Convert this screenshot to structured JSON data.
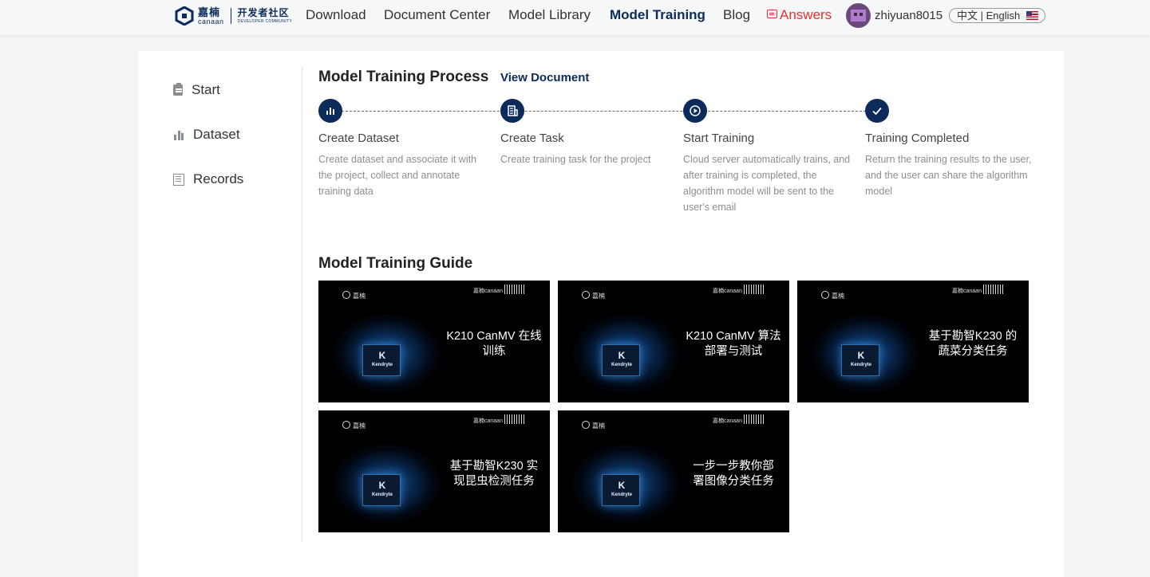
{
  "header": {
    "logo": {
      "cn": "嘉楠",
      "en": "canaan",
      "dev_cn": "开发者社区",
      "dev_en": "DEVELOPER COMMUNITY"
    },
    "nav": [
      {
        "label": "Download"
      },
      {
        "label": "Document Center"
      },
      {
        "label": "Model Library"
      },
      {
        "label": "Model Training",
        "active": true
      },
      {
        "label": "Blog"
      },
      {
        "label": "Answers"
      }
    ],
    "username": "zhiyuan8015",
    "language": "中文 | English"
  },
  "sidebar": {
    "items": [
      {
        "label": "Start",
        "icon": "clipboard-icon"
      },
      {
        "label": "Dataset",
        "icon": "bar-chart-icon"
      },
      {
        "label": "Records",
        "icon": "document-icon"
      }
    ]
  },
  "process": {
    "title": "Model Training Process",
    "view_document": "View Document",
    "steps": [
      {
        "title": "Create Dataset",
        "desc": "Create dataset and associate it with the project, collect and annotate training data",
        "icon": "bar-chart-icon"
      },
      {
        "title": "Create Task",
        "desc": "Create training task for the project",
        "icon": "building-icon"
      },
      {
        "title": "Start Training",
        "desc": "Cloud server automatically trains, and after training is completed, the algorithm model will be sent to the user's email",
        "icon": "play-circle-icon"
      },
      {
        "title": "Training Completed",
        "desc": "Return the training results to the user, and the user can share the algorithm model",
        "icon": "checkmark-icon"
      }
    ]
  },
  "guide": {
    "title": "Model Training Guide",
    "videos": [
      {
        "caption": "K210 CanMV 在线训练"
      },
      {
        "caption": "K210 CanMV 算法部署与测试"
      },
      {
        "caption": "基于勘智K230 的蔬菜分类任务"
      },
      {
        "caption": "基于勘智K230 实现昆虫检测任务"
      },
      {
        "caption": "一步一步教你部 署图像分类任务"
      }
    ],
    "thumb_logo_left": "嘉楠",
    "thumb_logo_right": "嘉楠canaan",
    "chip_brand": "K",
    "chip_text": "Kendryte"
  },
  "colors": {
    "brand": "#0b2c5a",
    "answers": "#e0322f"
  }
}
